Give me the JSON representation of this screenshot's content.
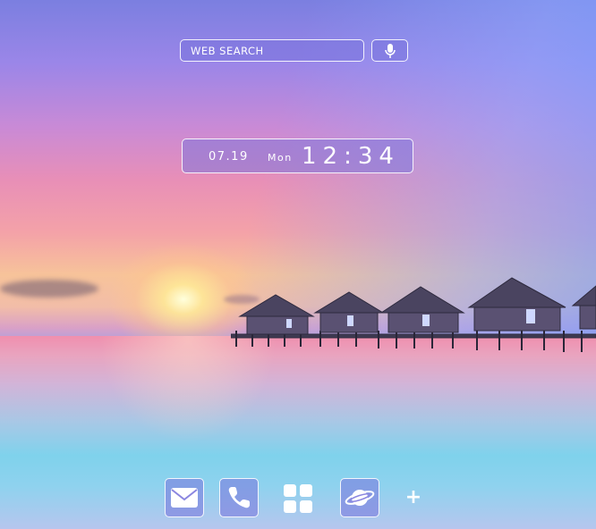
{
  "search": {
    "label": "WEB SEARCH"
  },
  "mic_button": {
    "icon": "microphone-icon"
  },
  "clock": {
    "date": "07.19",
    "day": "Mon",
    "time": "12:34"
  },
  "dock": {
    "items": [
      {
        "name": "mail",
        "icon": "mail-icon"
      },
      {
        "name": "phone",
        "icon": "phone-icon"
      },
      {
        "name": "apps",
        "icon": "app-grid-icon"
      },
      {
        "name": "browser",
        "icon": "planet-icon"
      }
    ],
    "add_label": "+"
  },
  "colors": {
    "widget_fill": "#7873dc",
    "widget_border": "#ffffff"
  }
}
